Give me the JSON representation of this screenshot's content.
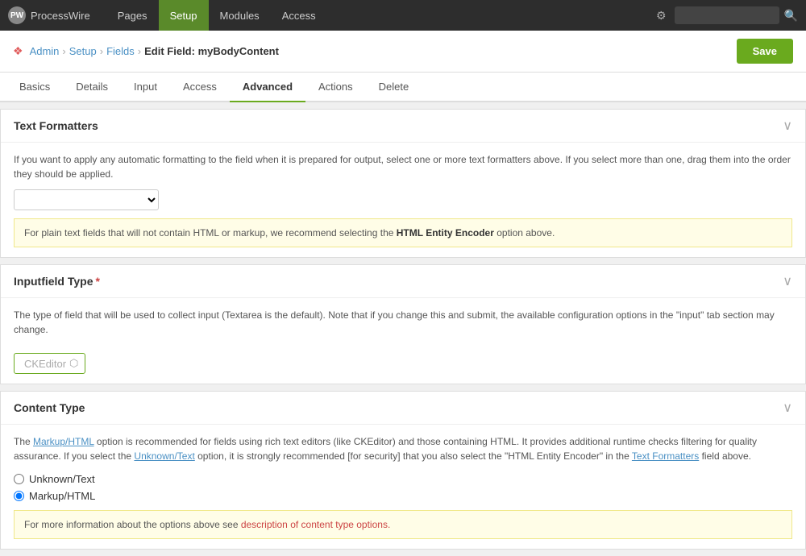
{
  "topNav": {
    "logo": "ProcessWire",
    "links": [
      {
        "label": "Pages",
        "active": false
      },
      {
        "label": "Setup",
        "active": true
      },
      {
        "label": "Modules",
        "active": false
      },
      {
        "label": "Access",
        "active": false
      }
    ],
    "searchPlaceholder": ""
  },
  "breadcrumb": {
    "icon": "❖",
    "items": [
      {
        "label": "Admin",
        "href": "#"
      },
      {
        "label": "Setup",
        "href": "#"
      },
      {
        "label": "Fields",
        "href": "#"
      }
    ],
    "current": "Edit Field: myBodyContent"
  },
  "saveButton": "Save",
  "tabs": [
    {
      "label": "Basics",
      "active": false
    },
    {
      "label": "Details",
      "active": false
    },
    {
      "label": "Input",
      "active": false
    },
    {
      "label": "Access",
      "active": false
    },
    {
      "label": "Advanced",
      "active": true
    },
    {
      "label": "Actions",
      "active": false
    },
    {
      "label": "Delete",
      "active": false
    }
  ],
  "sections": {
    "textFormatters": {
      "title": "Text Formatters",
      "desc": "If you want to apply any automatic formatting to the field when it is prepared for output, select one or more text formatters above. If you select more than one, drag them into the order they should be applied.",
      "selectPlaceholder": "",
      "infoText": "For plain text fields that will not contain HTML or markup, we recommend selecting the ",
      "infoLink": "HTML Entity Encoder",
      "infoTextAfter": " option above."
    },
    "inputfieldType": {
      "title": "Inputfield Type",
      "required": true,
      "desc": "The type of field that will be used to collect input (Textarea is the default). Note that if you change this and submit, the available configuration options in the \"input\" tab section may change.",
      "selectedValue": "CKEditor"
    },
    "contentType": {
      "title": "Content Type",
      "desc1": "The ",
      "desc1Link1": "Markup/HTML",
      "desc1Mid": " option is recommended for fields using rich text editors (like CKEditor) and those containing HTML. It provides additional runtime checks filtering for quality assurance. If you select the ",
      "desc1Link2": "Unknown/Text",
      "desc1End": " option, it is strongly recommended [for security] that you also select the \"HTML Entity Encoder\" in the ",
      "desc1Link3": "Text Formatters",
      "desc1Fin": " field above.",
      "options": [
        {
          "label": "Unknown/Text",
          "value": "unknown",
          "checked": false
        },
        {
          "label": "Markup/HTML",
          "value": "markup",
          "checked": true
        }
      ],
      "warnText": "For more information about the options above see ",
      "warnLink": "description of content type options.",
      "warnHref": "#"
    }
  }
}
